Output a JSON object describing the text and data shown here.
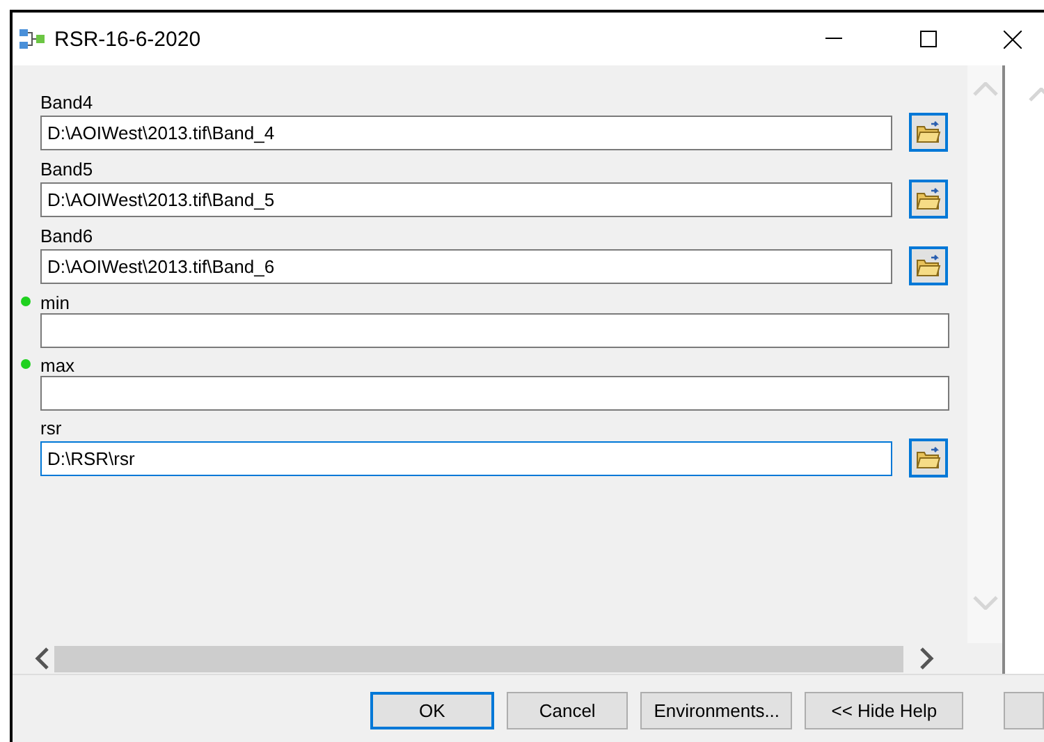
{
  "window": {
    "title": "RSR-16-6-2020"
  },
  "fields": [
    {
      "kind": "path",
      "label": "Band4",
      "value": "D:\\AOIWest\\2013.tif\\Band_4",
      "required": false,
      "focused": false
    },
    {
      "kind": "path",
      "label": "Band5",
      "value": "D:\\AOIWest\\2013.tif\\Band_5",
      "required": false,
      "focused": false
    },
    {
      "kind": "path",
      "label": "Band6",
      "value": "D:\\AOIWest\\2013.tif\\Band_6",
      "required": false,
      "focused": false
    },
    {
      "kind": "text",
      "label": "min",
      "required": true,
      "focused": false
    },
    {
      "kind": "text",
      "label": "max",
      "required": true,
      "focused": false
    },
    {
      "kind": "path",
      "label": "rsr",
      "value": "D:\\RSR\\rsr",
      "required": false,
      "focused": true
    }
  ],
  "buttons": [
    {
      "label": "OK",
      "default": true
    },
    {
      "label": "Cancel",
      "default": false
    },
    {
      "label": "Environments...",
      "default": false
    },
    {
      "label": "<< Hide Help",
      "default": false
    }
  ]
}
